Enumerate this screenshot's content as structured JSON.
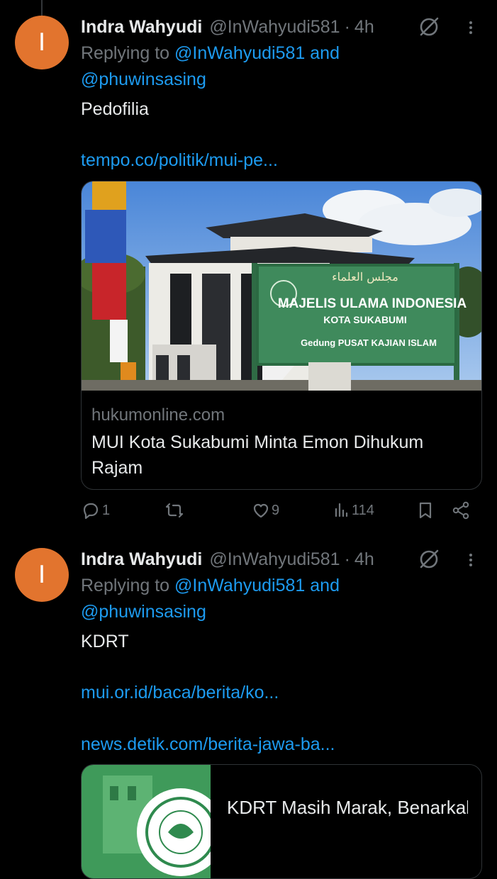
{
  "tweet1": {
    "avatar_letter": "I",
    "name": "Indra Wahyudi",
    "handle": "@InWahyudi581",
    "dot": "·",
    "time": "4h",
    "replying_prefix": "Replying to",
    "replying_mention1": "@InWahyudi581",
    "replying_and": "and",
    "replying_mention2": "@phuwinsasing",
    "text": "Pedofilia",
    "link": "tempo.co/politik/mui-pe...",
    "card": {
      "domain": "hukumonline.com",
      "title": "MUI Kota Sukabumi Minta Emon Dihukum Rajam",
      "image_sign_arabic": "مجلس العلماء",
      "image_sign_line1": "MAJELIS ULAMA INDONESIA",
      "image_sign_line2": "KOTA SUKABUMI",
      "image_sign_line3": "Gedung PUSAT KAJIAN ISLAM"
    },
    "actions": {
      "replies": "1",
      "reposts": "",
      "likes": "9",
      "views": "114"
    }
  },
  "tweet2": {
    "avatar_letter": "I",
    "name": "Indra Wahyudi",
    "handle": "@InWahyudi581",
    "dot": "·",
    "time": "4h",
    "replying_prefix": "Replying to",
    "replying_mention1": "@InWahyudi581",
    "replying_and": "and",
    "replying_mention2": "@phuwinsasing",
    "text": "KDRT",
    "link1": "mui.or.id/baca/berita/ko...",
    "link2": "news.detik.com/berita-jawa-ba...",
    "card": {
      "title": "KDRT Masih Marak, Benarkah Islam Bolehka..."
    }
  },
  "colors": {
    "background": "#000000",
    "text": "#e7e9ea",
    "muted": "#71767b",
    "link": "#1d9bf0",
    "avatar": "#e2742e",
    "border": "#2f3336"
  },
  "icons": [
    "grok-icon",
    "more-icon",
    "reply-icon",
    "repost-icon",
    "like-icon",
    "views-icon",
    "bookmark-icon",
    "share-icon"
  ]
}
